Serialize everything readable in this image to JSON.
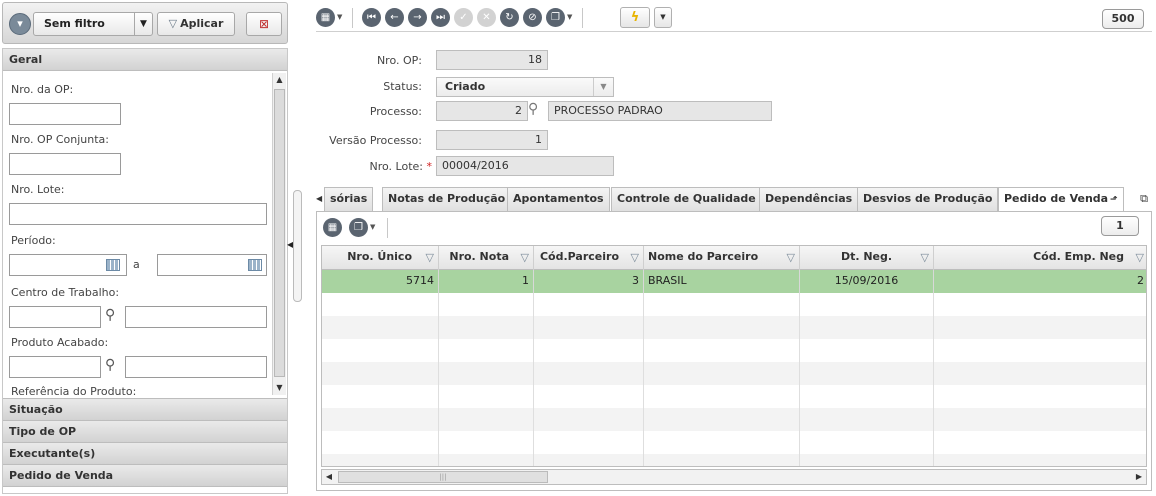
{
  "filter_bar": {
    "selected_filter": "Sem filtro",
    "apply_label": "Aplicar"
  },
  "left_sections": {
    "geral": {
      "title": "Geral",
      "fields": {
        "nro_op_label": "Nro. da OP:",
        "nro_op_conjunta_label": "Nro. OP Conjunta:",
        "nro_lote_label": "Nro. Lote:",
        "periodo_label": "Período:",
        "periodo_separator": "a",
        "centro_trabalho_label": "Centro de Trabalho:",
        "produto_acabado_label": "Produto Acabado:",
        "referencia_produto_label": "Referência do Produto:"
      }
    },
    "collapsed": [
      {
        "title": "Situação"
      },
      {
        "title": "Tipo de OP"
      },
      {
        "title": "Executante(s)"
      },
      {
        "title": "Pedido de Venda"
      }
    ]
  },
  "toolbar": {
    "record_count": "500"
  },
  "form": {
    "nro_op": {
      "label": "Nro. OP:",
      "value": "18"
    },
    "status": {
      "label": "Status:",
      "value": "Criado"
    },
    "processo": {
      "label": "Processo:",
      "code": "2",
      "name": "PROCESSO PADRAO"
    },
    "versao_processo": {
      "label": "Versão Processo:",
      "value": "1"
    },
    "nro_lote": {
      "label": "Nro. Lote:",
      "value": "00004/2016"
    }
  },
  "tabs": [
    {
      "label": "sórias"
    },
    {
      "label": "Notas de Produção"
    },
    {
      "label": "Apontamentos"
    },
    {
      "label": "Controle de Qualidade"
    },
    {
      "label": "Dependências"
    },
    {
      "label": "Desvios de Produção"
    },
    {
      "label": "Pedido de Venda",
      "active": true
    }
  ],
  "grid": {
    "page_indicator": "1",
    "columns": [
      {
        "label": "Nro. Único"
      },
      {
        "label": "Nro. Nota"
      },
      {
        "label": "Cód.Parceiro"
      },
      {
        "label": "Nome do Parceiro"
      },
      {
        "label": "Dt. Neg."
      },
      {
        "label": "Cód. Emp. Neg"
      }
    ],
    "rows": [
      {
        "nro_unico": "5714",
        "nro_nota": "1",
        "cod_parceiro": "3",
        "nome_parceiro": "BRASIL",
        "dt_neg": "15/09/2016",
        "cod_emp_neg": "2"
      }
    ]
  }
}
